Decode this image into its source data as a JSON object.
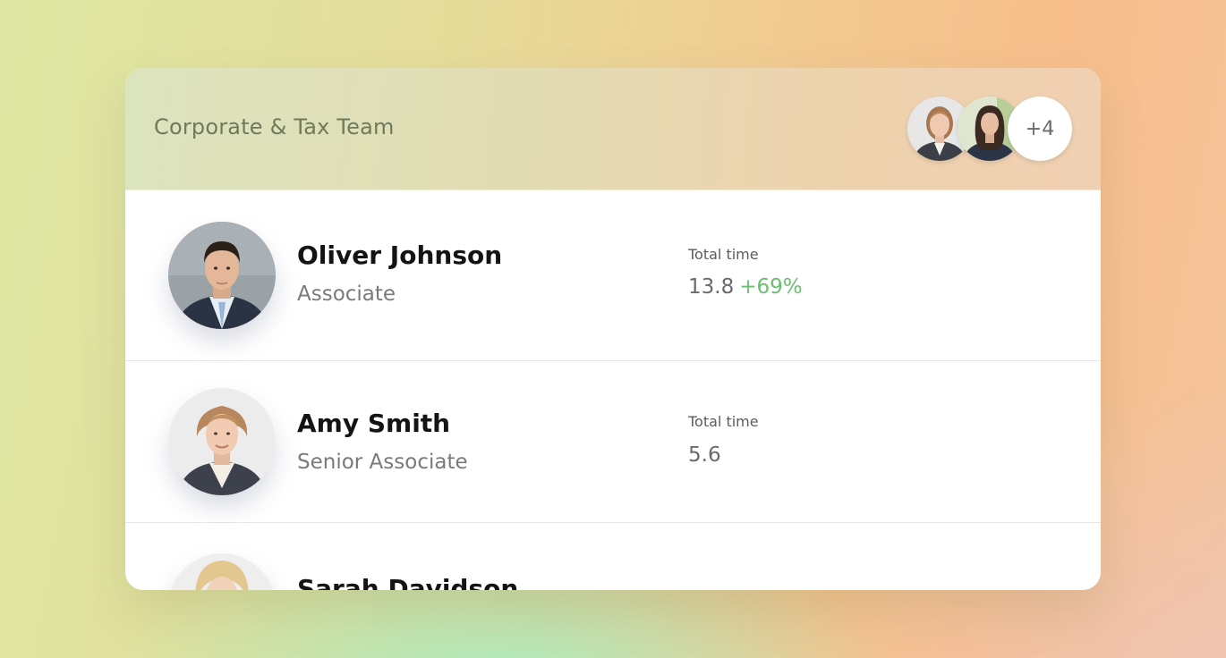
{
  "team": {
    "title": "Corporate & Tax Team",
    "more_count": "+4",
    "stack_avatars": [
      "woman-blonde-avatar",
      "woman-brunette-avatar"
    ]
  },
  "members": [
    {
      "name": "Oliver Johnson",
      "role": "Associate",
      "metric_label": "Total time",
      "metric_value": "13.8",
      "metric_change": "+69%",
      "avatar": "man-suit-avatar"
    },
    {
      "name": "Amy Smith",
      "role": "Senior Associate",
      "metric_label": "Total time",
      "metric_value": "5.6",
      "metric_change": "",
      "avatar": "woman-blonde-avatar"
    },
    {
      "name": "Sarah Davidson",
      "avatar": "woman-light-hair-avatar"
    }
  ],
  "colors": {
    "positive_change": "#6cbf6e",
    "title_text": "#6f7a5c"
  }
}
